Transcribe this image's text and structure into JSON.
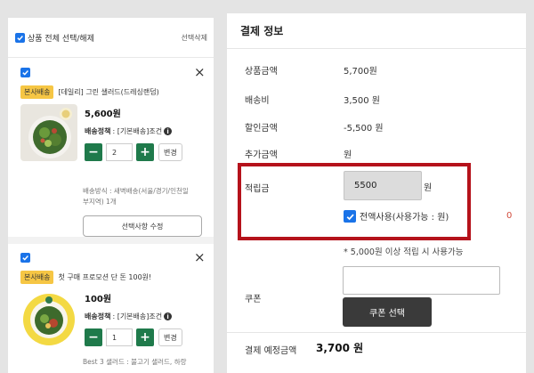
{
  "cart": {
    "select_all_label": "상품 전체 선택/해제",
    "delete_selected_label": "선택삭제",
    "items": [
      {
        "badge": "본사배송",
        "title": "[데일리] 그린 샐러드(드레싱랜덤)",
        "price": "5,600원",
        "policy_prefix": "배송정책",
        "policy_value": " : [기본배송]조건",
        "quantity": "2",
        "change_label": "변경",
        "shipping_line1": "배송방식 : 새벽배송(서울/경기/인천일",
        "shipping_line2": "부지역) 1개",
        "option_button": "선택사항 수정"
      },
      {
        "badge": "본사배송",
        "title": "첫 구매 프로모션 단 돈 100원!",
        "price": "100원",
        "policy_prefix": "배송정책",
        "policy_value": " : [기본배송]조건",
        "quantity": "1",
        "change_label": "변경",
        "best": "Best 3 샐러드 : 불고기 샐러드, 하랑"
      }
    ]
  },
  "payment": {
    "title": "결제 정보",
    "product_amount_label": "상품금액",
    "product_amount": "5,700원",
    "shipping_label": "배송비",
    "shipping": "3,500 원",
    "discount_label": "할인금액",
    "discount": "-5,500 원",
    "extra_label": "추가금액",
    "extra": "원",
    "points_label": "적립금",
    "points_value": "5500",
    "points_unit": "원",
    "use_all_label": "전액사용(사용가능 : 원)",
    "available_points": "0",
    "points_notice": "* 5,000원 이상 적립 시 사용가능",
    "coupon_label": "쿠폰",
    "coupon_button": "쿠폰 선택",
    "total_label": "결제 예정금액",
    "total": "3,700 원"
  },
  "colors": {
    "accent_blue": "#1a73e8",
    "qty_green": "#1f7a4b",
    "badge_yellow": "#f6c644",
    "highlight_red": "#b5121b",
    "coupon_button_dark": "#3a3a3a"
  }
}
